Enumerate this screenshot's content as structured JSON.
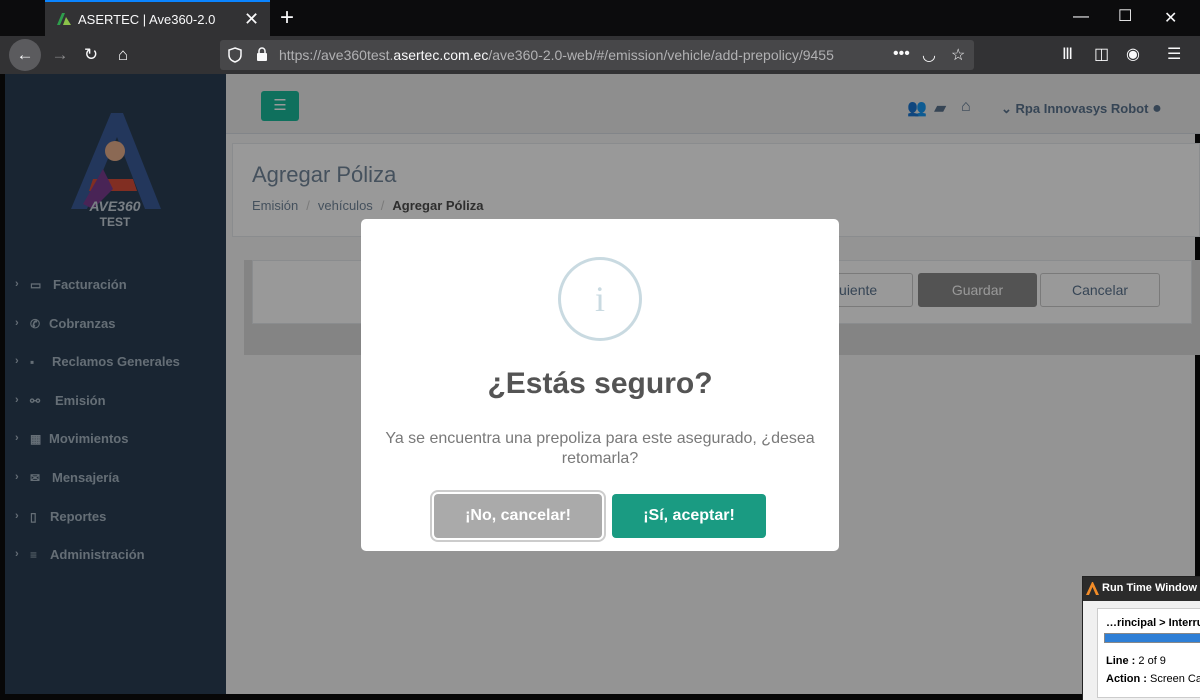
{
  "browser": {
    "tab_title": "ASERTEC | Ave360-2.0",
    "new_tab": "+",
    "url_prefix": "https://ave360test.",
    "url_domain": "asertec.com.ec",
    "url_path": "/ave360-2.0-web/#/emission/vehicle/add-prepolicy/9455"
  },
  "sidebar": {
    "logo_text": "AVE360",
    "logo_sub": "TEST",
    "items": [
      {
        "label": "Facturación",
        "icon": "money-icon"
      },
      {
        "label": "Cobranzas",
        "icon": "phone-icon"
      },
      {
        "label": "Reclamos Generales",
        "icon": "briefcase-icon"
      },
      {
        "label": "Emisión",
        "icon": "handshake-icon"
      },
      {
        "label": "Movimientos",
        "icon": "qrcode-icon"
      },
      {
        "label": "Mensajería",
        "icon": "envelope-icon"
      },
      {
        "label": "Reportes",
        "icon": "file-icon"
      },
      {
        "label": "Administración",
        "icon": "bars-icon"
      }
    ]
  },
  "topnav": {
    "user_name": "Rpa Innovasys Robot"
  },
  "page": {
    "title": "Agregar Póliza",
    "breadcrumb": [
      "Emisión",
      "vehículos",
      "Agregar Póliza"
    ]
  },
  "panel": {
    "next_label": "Siguiente",
    "save_label": "Guardar",
    "cancel_label": "Cancelar"
  },
  "modal": {
    "icon_glyph": "i",
    "title": "¿Estás seguro?",
    "text": "Ya se encuentra una prepoliza para este asegurado, ¿desea retomarla?",
    "cancel_label": "¡No, cancelar!",
    "confirm_label": "¡Sí, aceptar!"
  },
  "runtime": {
    "title": "Run Time Window",
    "crumb": "…rincipal > Interru",
    "progress_pct": 100,
    "line_label": "Line :",
    "line_value": "2 of 9",
    "action_label": "Action :",
    "action_value": "Screen Ca"
  },
  "colors": {
    "accent": "#1abb9c",
    "confirm": "#1a9b82",
    "sidebar": "#2a3f54"
  }
}
